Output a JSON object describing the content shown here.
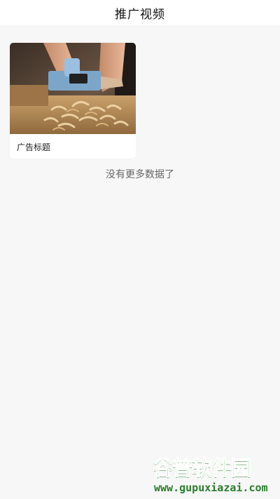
{
  "header": {
    "title": "推广视频"
  },
  "videos": [
    {
      "caption": "广告标题",
      "thumbnail": "woodworking-plane-image"
    }
  ],
  "list_end_text": "没有更多数据了",
  "watermark": {
    "brand_text": "谷普软件园",
    "url_text": "www.gupuxiazai.com"
  },
  "colors": {
    "page_bg": "#f7f7f7",
    "header_bg": "#ffffff",
    "watermark_green": "#2fa634"
  }
}
